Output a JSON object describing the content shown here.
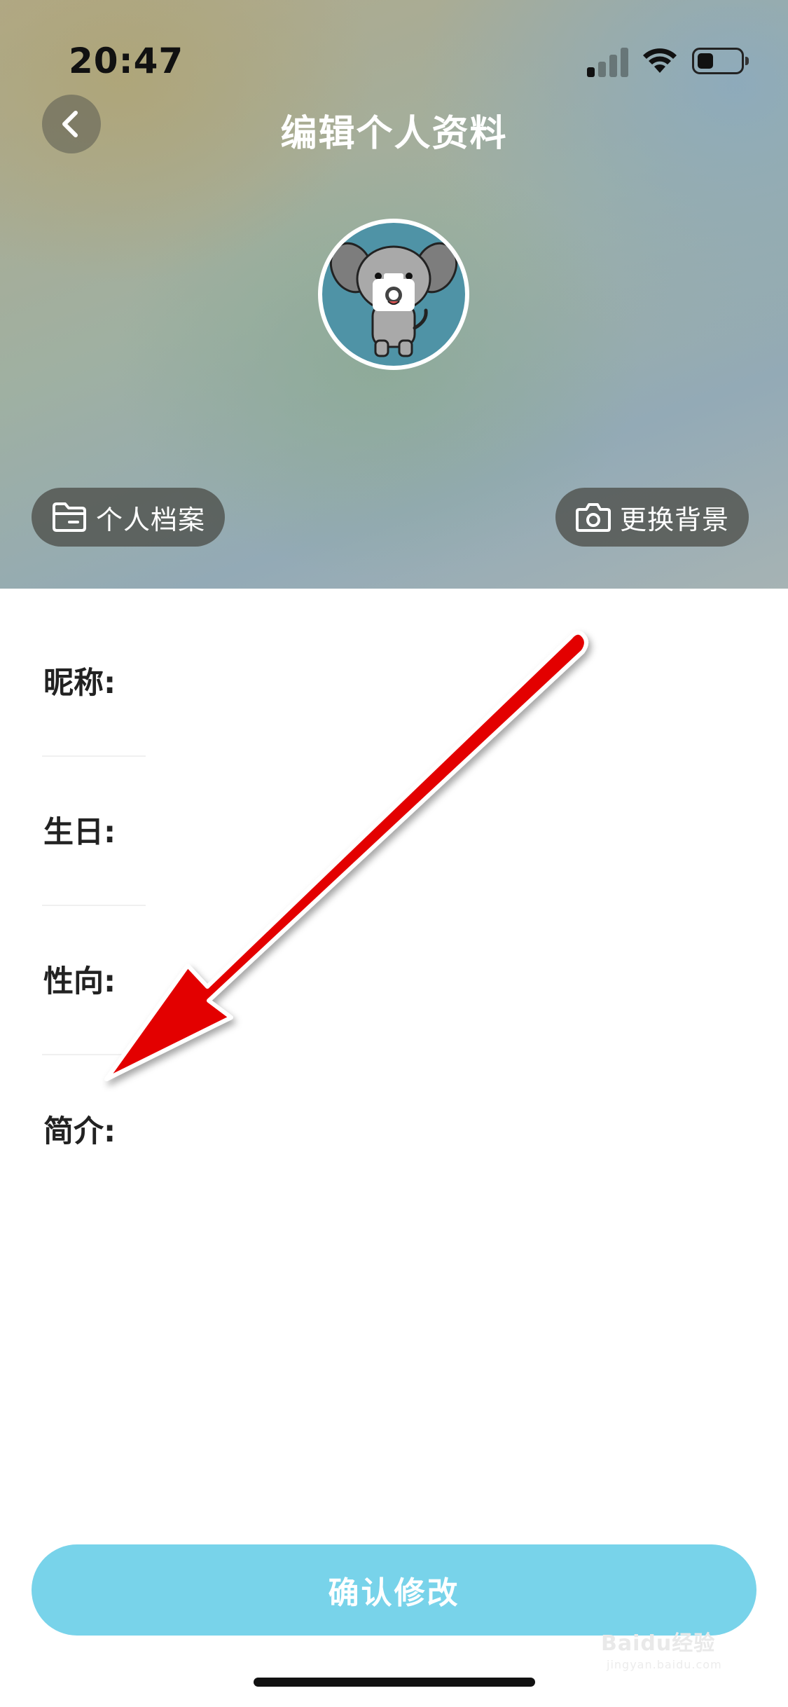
{
  "status_bar": {
    "time": "20:47"
  },
  "header": {
    "title": "编辑个人资料",
    "profile_chip": "个人档案",
    "background_chip": "更换背景"
  },
  "form": {
    "rows": [
      {
        "label": "昵称:",
        "value": "",
        "action": ""
      },
      {
        "label": "生日:",
        "value": "",
        "action": ""
      },
      {
        "label": "性向:",
        "value": "",
        "action": ""
      },
      {
        "label": "简介:",
        "value": "",
        "action": ""
      }
    ]
  },
  "confirm_button": "确认修改",
  "watermark": {
    "brand": "Baidu经验",
    "url": "jingyan.baidu.com"
  },
  "colors": {
    "accent": "#78d3ea",
    "annotation_arrow": "#e30000",
    "avatar_bg": "#4f93a6"
  }
}
